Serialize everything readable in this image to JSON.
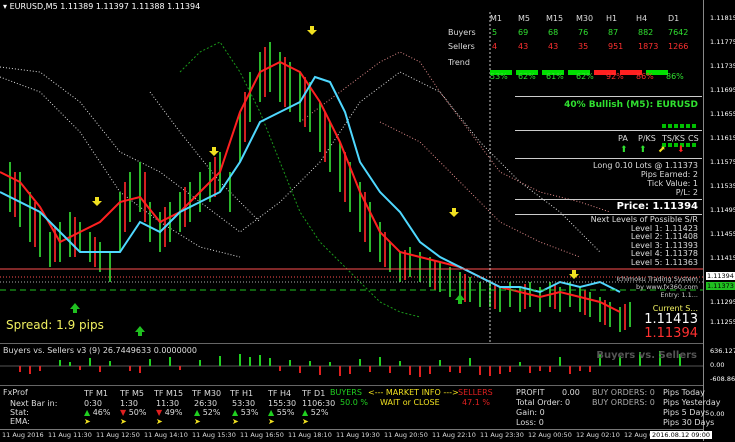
{
  "chart_header": {
    "symbol": "EURUSD,M5",
    "ohlc": "1.11389 1.11397 1.11388 1.11394"
  },
  "price_axis": [
    "1.11815",
    "1.11775",
    "1.11735",
    "1.11695",
    "1.11655",
    "1.11615",
    "1.11575",
    "1.11535",
    "1.11495",
    "1.11455",
    "1.11415",
    "1.11375",
    "1.11335",
    "1.11295",
    "1.11255",
    "1.11215",
    "1.11175",
    "1.11135"
  ],
  "price_tags": [
    "1.11394",
    "1.11373"
  ],
  "sub_axis": [
    "636.1278",
    "0.00",
    "-608.8652"
  ],
  "bot_axis": [
    "0.00"
  ],
  "dashboard": {
    "timeframes": [
      "M1",
      "M5",
      "M15",
      "M30",
      "H1",
      "H4",
      "D1"
    ],
    "buyers_label": "Buyers",
    "buyers": [
      "5",
      "69",
      "68",
      "76",
      "87",
      "882",
      "7642"
    ],
    "sellers_label": "Sellers",
    "sellers": [
      "4",
      "43",
      "43",
      "35",
      "951",
      "1873",
      "1266"
    ],
    "trend_label": "Trend",
    "trend_pct": [
      "53%",
      "62%",
      "61%",
      "62%",
      "92%",
      "86%",
      "86%"
    ],
    "bullish": "40% Bullish (M5): EURUSD",
    "signals": [
      "PA",
      "P/KS",
      "TS/KS",
      "CS"
    ],
    "position": [
      "Long 0.10 Lots @ 1.11373",
      "Pips Earned: 2",
      "Tick Value: 1",
      "P/L: 2"
    ],
    "price_label": "Price: 1.11394",
    "levels_title": "Next Levels of Possible S/R",
    "levels": [
      "Level 1: 1.11423",
      "Level 2: 1.11408",
      "Level 3: 1.11393",
      "Level 4: 1.11378",
      "Level 5: 1.11363"
    ],
    "system": [
      "Ichimoku Trading System",
      "by www.fx360.com",
      "Entry: 1.1..."
    ],
    "current_s": "Current S...",
    "big_price": "1.11413",
    "big_price_red": "1.11394"
  },
  "spread": "Spread: 1.9 pips",
  "subwindow": {
    "title": "Buyers vs. Sellers v3 (9) 26.7449633 0.0000000",
    "watermark": "Buyers vs. Sellers"
  },
  "bottom": {
    "title": "FxProf",
    "rows": [
      "Next Bar in:",
      "Stat:",
      "EMA:"
    ],
    "tf": [
      "TF M1",
      "TF M5",
      "TF M15",
      "TF M30",
      "TF H1",
      "TF H4",
      "TF D1"
    ],
    "next_bar": [
      "0:30",
      "1:30",
      "11:30",
      "26:30",
      "53:30",
      "155:30",
      "1106:30"
    ],
    "stat": [
      "46%",
      "50%",
      "49%",
      "52%",
      "53%",
      "55%",
      "52%"
    ],
    "buyers": "BUYERS",
    "buyers_pct": "50.0 %",
    "market_info": "<--- MARKET INFO --->",
    "advice": "WAIT or CLOSE",
    "sellers": "SELLERS",
    "sellers_pct": "47.1 %",
    "profit_label": "PROFIT",
    "profit_val": "0.00",
    "total_order": "Total Order: 0",
    "gain": "Gain: 0",
    "loss": "Loss: 0",
    "buy_orders": "BUY ORDERS:",
    "buy_orders_val": "0",
    "sell_orders": "BUY ORDERS:",
    "sell_orders_val": "0",
    "pips_today": "Pips Today",
    "pips_yest": "Pips Yesterday",
    "pips_5d": "Pips 5 Days",
    "pips_30": "Pips 30 Days"
  },
  "time_axis": [
    "11 Aug 2016",
    "11 Aug 11:30",
    "11 Aug 12:50",
    "11 Aug 14:10",
    "11 Aug 15:30",
    "11 Aug 16:50",
    "11 Aug 18:10",
    "11 Aug 19:30",
    "11 Aug 20:50",
    "11 Aug 22:10",
    "11 Aug 23:30",
    "12 Aug 00:50",
    "12 Aug 02:10",
    "12 Aug 03:30"
  ],
  "time_tag": "2016.08.12 09:00"
}
